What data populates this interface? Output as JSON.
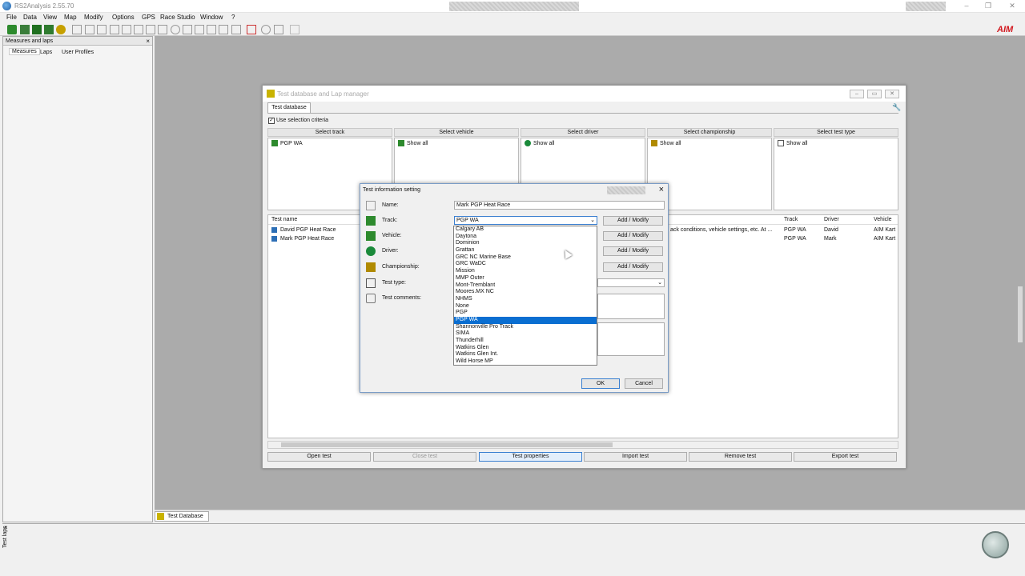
{
  "app": {
    "title": "RS2Analysis 2.55.70",
    "logo": "AIM"
  },
  "menu": [
    "File",
    "Data",
    "View",
    "Map",
    "Modify",
    "Options",
    "GPS",
    "Race Studio",
    "Window",
    "?"
  ],
  "left_panel": {
    "title": "Measures and laps",
    "tabs": [
      "Measures",
      "Laps",
      "User Profiles"
    ],
    "vertical_label": "Test laps"
  },
  "main_window": {
    "title": "Test database and Lap manager",
    "tab": "Test database",
    "use_selection_criteria": "Use selection criteria",
    "selectors": [
      {
        "header": "Select track",
        "item": "PGP WA"
      },
      {
        "header": "Select vehicle",
        "item": "Show all"
      },
      {
        "header": "Select driver",
        "item": "Show all"
      },
      {
        "header": "Select championship",
        "item": "Show all"
      },
      {
        "header": "Select test type",
        "item": "Show all"
      }
    ],
    "grid": {
      "headers": {
        "name": "Test name",
        "track": "Track",
        "driver": "Driver",
        "vehicle": "Vehicle"
      },
      "comment_frag": "ack conditions, vehicle settings, etc. At ...",
      "rows": [
        {
          "name": "David PGP Heat Race",
          "track": "PGP WA",
          "driver": "David",
          "vehicle": "AIM Kart"
        },
        {
          "name": "Mark PGP Heat Race",
          "track": "PGP WA",
          "driver": "Mark",
          "vehicle": "AIM Kart"
        }
      ]
    },
    "buttons": [
      "Open test",
      "Close test",
      "Test properties",
      "Import test",
      "Remove test",
      "Export test"
    ]
  },
  "dialog": {
    "title": "Test information setting",
    "name_label": "Name:",
    "name_value": "Mark PGP Heat Race",
    "track_label": "Track:",
    "track_value": "PGP WA",
    "vehicle_label": "Vehicle:",
    "driver_label": "Driver:",
    "championship_label": "Championship:",
    "testtype_label": "Test type:",
    "comments_label": "Test comments:",
    "add_modify": "Add / Modify",
    "ok": "OK",
    "cancel": "Cancel",
    "track_options": [
      "Calgary AB",
      "Daytona",
      "Dominion",
      "Grattan",
      "GRC NC Marine Base",
      "GRC WaDC",
      "Mission",
      "MMP Outer",
      "Mont-Tremblant",
      "Moores.MX NC",
      "NHMS",
      "None",
      "PGP",
      "PGP WA",
      "Shannonville Pro Track",
      "SIMA",
      "Thunderhill",
      "Watkins Glen",
      "Watkins Glen Int.",
      "Wild Horse MP"
    ],
    "selected_index": 13
  },
  "bottom_tab": "Test Database"
}
